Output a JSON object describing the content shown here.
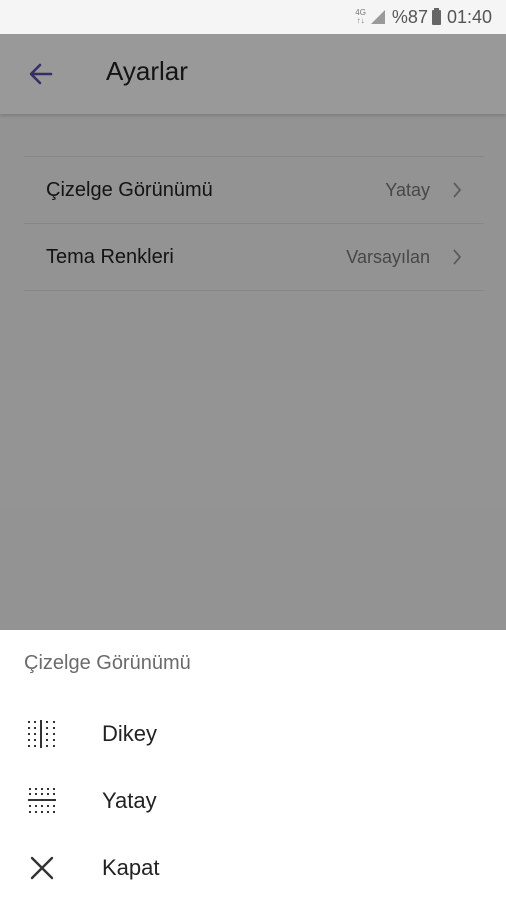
{
  "status_bar": {
    "network": "4G",
    "network_sub": "↑↓",
    "battery": "%87",
    "time": "01:40",
    "icons": [
      "signal-icon",
      "battery-icon"
    ]
  },
  "app_bar": {
    "back_icon": "arrow-left-icon",
    "title": "Ayarlar",
    "accent_color": "#5b4ea8"
  },
  "settings": {
    "rows": [
      {
        "label": "Çizelge Görünümü",
        "value": "Yatay",
        "icon": "chevron-right-icon"
      },
      {
        "label": "Tema Renkleri",
        "value": "Varsayılan",
        "icon": "chevron-right-icon"
      }
    ]
  },
  "sheet": {
    "title": "Çizelge Görünümü",
    "items": [
      {
        "label": "Dikey",
        "icon": "vertical-layout-icon"
      },
      {
        "label": "Yatay",
        "icon": "horizontal-layout-icon"
      },
      {
        "label": "Kapat",
        "icon": "close-icon"
      }
    ]
  }
}
